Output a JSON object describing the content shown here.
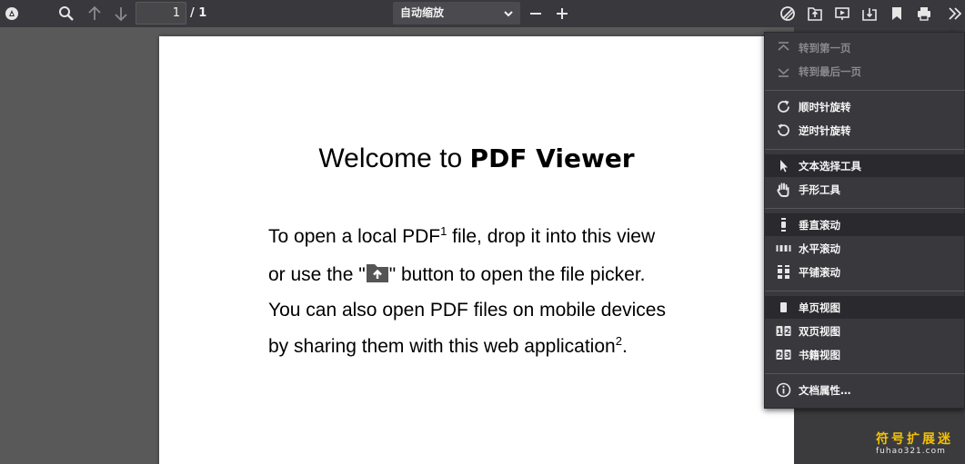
{
  "toolbar": {
    "page_value": "1",
    "page_total": "/ 1",
    "zoom_selected": "自动缩放"
  },
  "document": {
    "title_plain": "Welcome to ",
    "title_bold": "PDF Viewer",
    "line1_a": "To open a local PDF",
    "sup1": "1",
    "line1_b": " file, drop it into this view",
    "line2_a": "or use the \"",
    "line2_b": "\" button to open the file picker.",
    "line3": "You can also open PDF files on mobile devices",
    "line4_a": "by sharing them with this web application",
    "sup2": "2",
    "line4_b": "."
  },
  "menu": {
    "first_page": "转到第一页",
    "last_page": "转到最后一页",
    "rotate_cw": "顺时针旋转",
    "rotate_ccw": "逆时针旋转",
    "text_select": "文本选择工具",
    "hand_tool": "手形工具",
    "vertical_scroll": "垂直滚动",
    "horizontal_scroll": "水平滚动",
    "wrapped_scroll": "平铺滚动",
    "single_page": "单页视图",
    "two_page": "双页视图",
    "book_view": "书籍视图",
    "doc_properties": "文档属性…"
  },
  "watermark": {
    "zh": "符号扩展迷",
    "en": "fuhao321.com"
  },
  "colors": {
    "toolbar_bg": "#38383d",
    "canvas_bg": "#595959",
    "menu_bg": "#38383d",
    "menu_active_bg": "#2a2a2e",
    "watermark": "#f5c000"
  }
}
